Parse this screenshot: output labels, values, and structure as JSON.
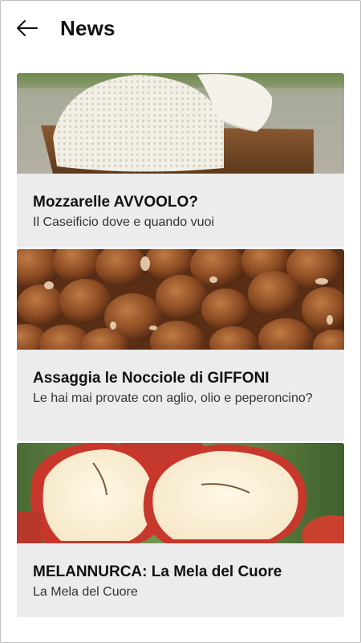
{
  "header": {
    "title": "News",
    "back_icon": "arrow-left-icon"
  },
  "news": [
    {
      "title": "Mozzarelle AVVOOLO?",
      "subtitle": "Il Caseificio dove e quando vuoi",
      "image": "mozzarella-photo"
    },
    {
      "title": "Assaggia le Nocciole di GIFFONI",
      "subtitle": "Le hai mai provate con aglio, olio e peperoncino?",
      "image": "hazelnuts-photo"
    },
    {
      "title": "MELANNURCA: La Mela del Cuore",
      "subtitle": "La Mela del Cuore",
      "image": "apples-photo"
    }
  ]
}
